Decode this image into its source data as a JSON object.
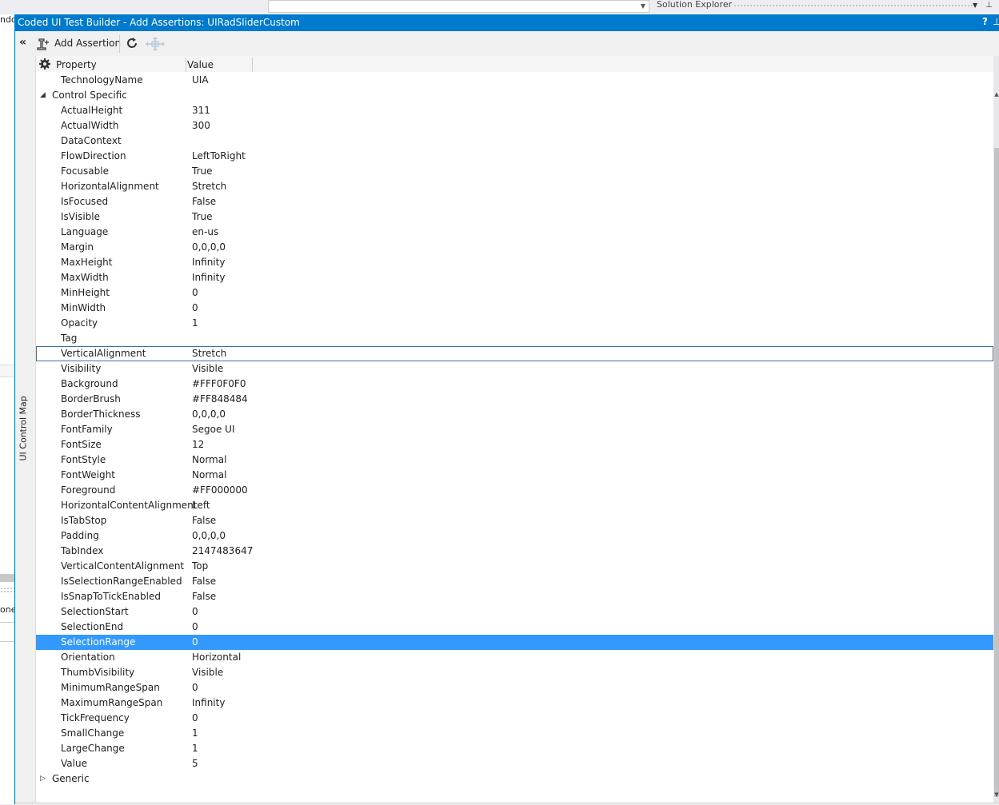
{
  "background": {
    "left_text_1": "ndo",
    "left_text_2": "one",
    "solution_explorer_title": "Solution Explorer"
  },
  "dialog": {
    "title": "Coded UI Test Builder - Add Assertions: UIRadSliderCustom",
    "help": "?",
    "toolbar": {
      "add_assertion_label": "Add Assertion"
    },
    "side_tab_label": "UI Control Map",
    "grid": {
      "header_property": "Property",
      "header_value": "Value",
      "rows": [
        {
          "type": "prop",
          "name": "TechnologyName",
          "value": "UIA"
        },
        {
          "type": "cat",
          "name": "Control Specific",
          "expanded": true
        },
        {
          "type": "prop",
          "name": "ActualHeight",
          "value": "311"
        },
        {
          "type": "prop",
          "name": "ActualWidth",
          "value": "300"
        },
        {
          "type": "prop",
          "name": "DataContext",
          "value": ""
        },
        {
          "type": "prop",
          "name": "FlowDirection",
          "value": "LeftToRight"
        },
        {
          "type": "prop",
          "name": "Focusable",
          "value": "True"
        },
        {
          "type": "prop",
          "name": "HorizontalAlignment",
          "value": "Stretch"
        },
        {
          "type": "prop",
          "name": "IsFocused",
          "value": "False"
        },
        {
          "type": "prop",
          "name": "IsVisible",
          "value": "True"
        },
        {
          "type": "prop",
          "name": "Language",
          "value": "en-us"
        },
        {
          "type": "prop",
          "name": "Margin",
          "value": "0,0,0,0"
        },
        {
          "type": "prop",
          "name": "MaxHeight",
          "value": "Infinity"
        },
        {
          "type": "prop",
          "name": "MaxWidth",
          "value": "Infinity"
        },
        {
          "type": "prop",
          "name": "MinHeight",
          "value": "0"
        },
        {
          "type": "prop",
          "name": "MinWidth",
          "value": "0"
        },
        {
          "type": "prop",
          "name": "Opacity",
          "value": "1"
        },
        {
          "type": "prop",
          "name": "Tag",
          "value": ""
        },
        {
          "type": "prop",
          "name": "VerticalAlignment",
          "value": "Stretch",
          "state": "focused"
        },
        {
          "type": "prop",
          "name": "Visibility",
          "value": "Visible"
        },
        {
          "type": "prop",
          "name": "Background",
          "value": "#FFF0F0F0"
        },
        {
          "type": "prop",
          "name": "BorderBrush",
          "value": "#FF848484"
        },
        {
          "type": "prop",
          "name": "BorderThickness",
          "value": "0,0,0,0"
        },
        {
          "type": "prop",
          "name": "FontFamily",
          "value": "Segoe UI"
        },
        {
          "type": "prop",
          "name": "FontSize",
          "value": "12"
        },
        {
          "type": "prop",
          "name": "FontStyle",
          "value": "Normal"
        },
        {
          "type": "prop",
          "name": "FontWeight",
          "value": "Normal"
        },
        {
          "type": "prop",
          "name": "Foreground",
          "value": "#FF000000"
        },
        {
          "type": "prop",
          "name": "HorizontalContentAlignment",
          "value": "Left"
        },
        {
          "type": "prop",
          "name": "IsTabStop",
          "value": "False"
        },
        {
          "type": "prop",
          "name": "Padding",
          "value": "0,0,0,0"
        },
        {
          "type": "prop",
          "name": "TabIndex",
          "value": "2147483647"
        },
        {
          "type": "prop",
          "name": "VerticalContentAlignment",
          "value": "Top"
        },
        {
          "type": "prop",
          "name": "IsSelectionRangeEnabled",
          "value": "False"
        },
        {
          "type": "prop",
          "name": "IsSnapToTickEnabled",
          "value": "False"
        },
        {
          "type": "prop",
          "name": "SelectionStart",
          "value": "0"
        },
        {
          "type": "prop",
          "name": "SelectionEnd",
          "value": "0"
        },
        {
          "type": "prop",
          "name": "SelectionRange",
          "value": "0",
          "state": "selected"
        },
        {
          "type": "prop",
          "name": "Orientation",
          "value": "Horizontal"
        },
        {
          "type": "prop",
          "name": "ThumbVisibility",
          "value": "Visible"
        },
        {
          "type": "prop",
          "name": "MinimumRangeSpan",
          "value": "0"
        },
        {
          "type": "prop",
          "name": "MaximumRangeSpan",
          "value": "Infinity"
        },
        {
          "type": "prop",
          "name": "TickFrequency",
          "value": "0"
        },
        {
          "type": "prop",
          "name": "SmallChange",
          "value": "1"
        },
        {
          "type": "prop",
          "name": "LargeChange",
          "value": "1"
        },
        {
          "type": "prop",
          "name": "Value",
          "value": "5"
        },
        {
          "type": "cat",
          "name": "Generic",
          "expanded": false
        }
      ]
    }
  },
  "colors": {
    "accent": "#007acc",
    "selection": "#3399ff",
    "focus_border": "#3b6fa5"
  }
}
